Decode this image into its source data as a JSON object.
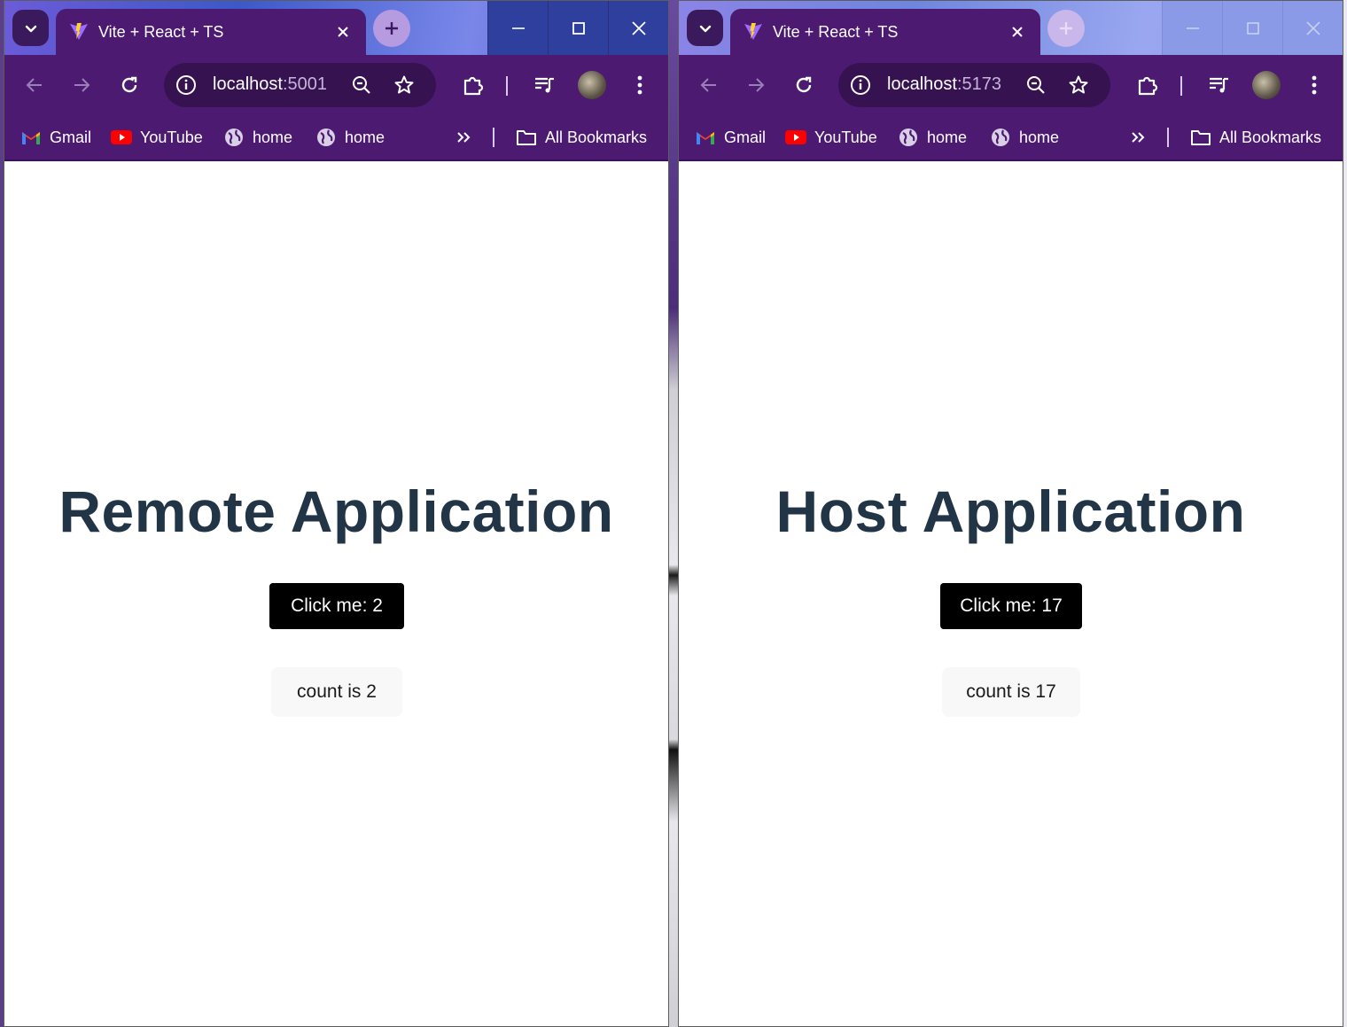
{
  "colors": {
    "tab_strip": "#4d1a72",
    "heading": "#213547",
    "button_dark": "#000000",
    "button_light": "#f8f8f8"
  },
  "windows": [
    {
      "id": "remote",
      "tab_title": "Vite + React + TS",
      "url_host": "localhost",
      "url_port": ":5001",
      "bookmarks": [
        "Gmail",
        "YouTube",
        "home",
        "home"
      ],
      "all_bookmarks": "All Bookmarks",
      "heading": "Remote Application",
      "click_button": "Click me: 2",
      "count_button": "count is 2"
    },
    {
      "id": "host",
      "tab_title": "Vite + React + TS",
      "url_host": "localhost",
      "url_port": ":5173",
      "bookmarks": [
        "Gmail",
        "YouTube",
        "home",
        "home"
      ],
      "all_bookmarks": "All Bookmarks",
      "heading": "Host Application",
      "click_button": "Click me: 17",
      "count_button": "count is 17"
    }
  ],
  "icons": [
    "tab-search-icon",
    "vite-favicon-icon",
    "close-icon",
    "plus-icon",
    "minimize-icon",
    "maximize-icon",
    "back-icon",
    "forward-icon",
    "reload-icon",
    "info-icon",
    "zoom-icon",
    "star-icon",
    "extensions-icon",
    "media-icon",
    "avatar",
    "menu-icon",
    "gmail-icon",
    "youtube-icon",
    "globe-icon",
    "chevron-double-right-icon",
    "folder-icon"
  ]
}
